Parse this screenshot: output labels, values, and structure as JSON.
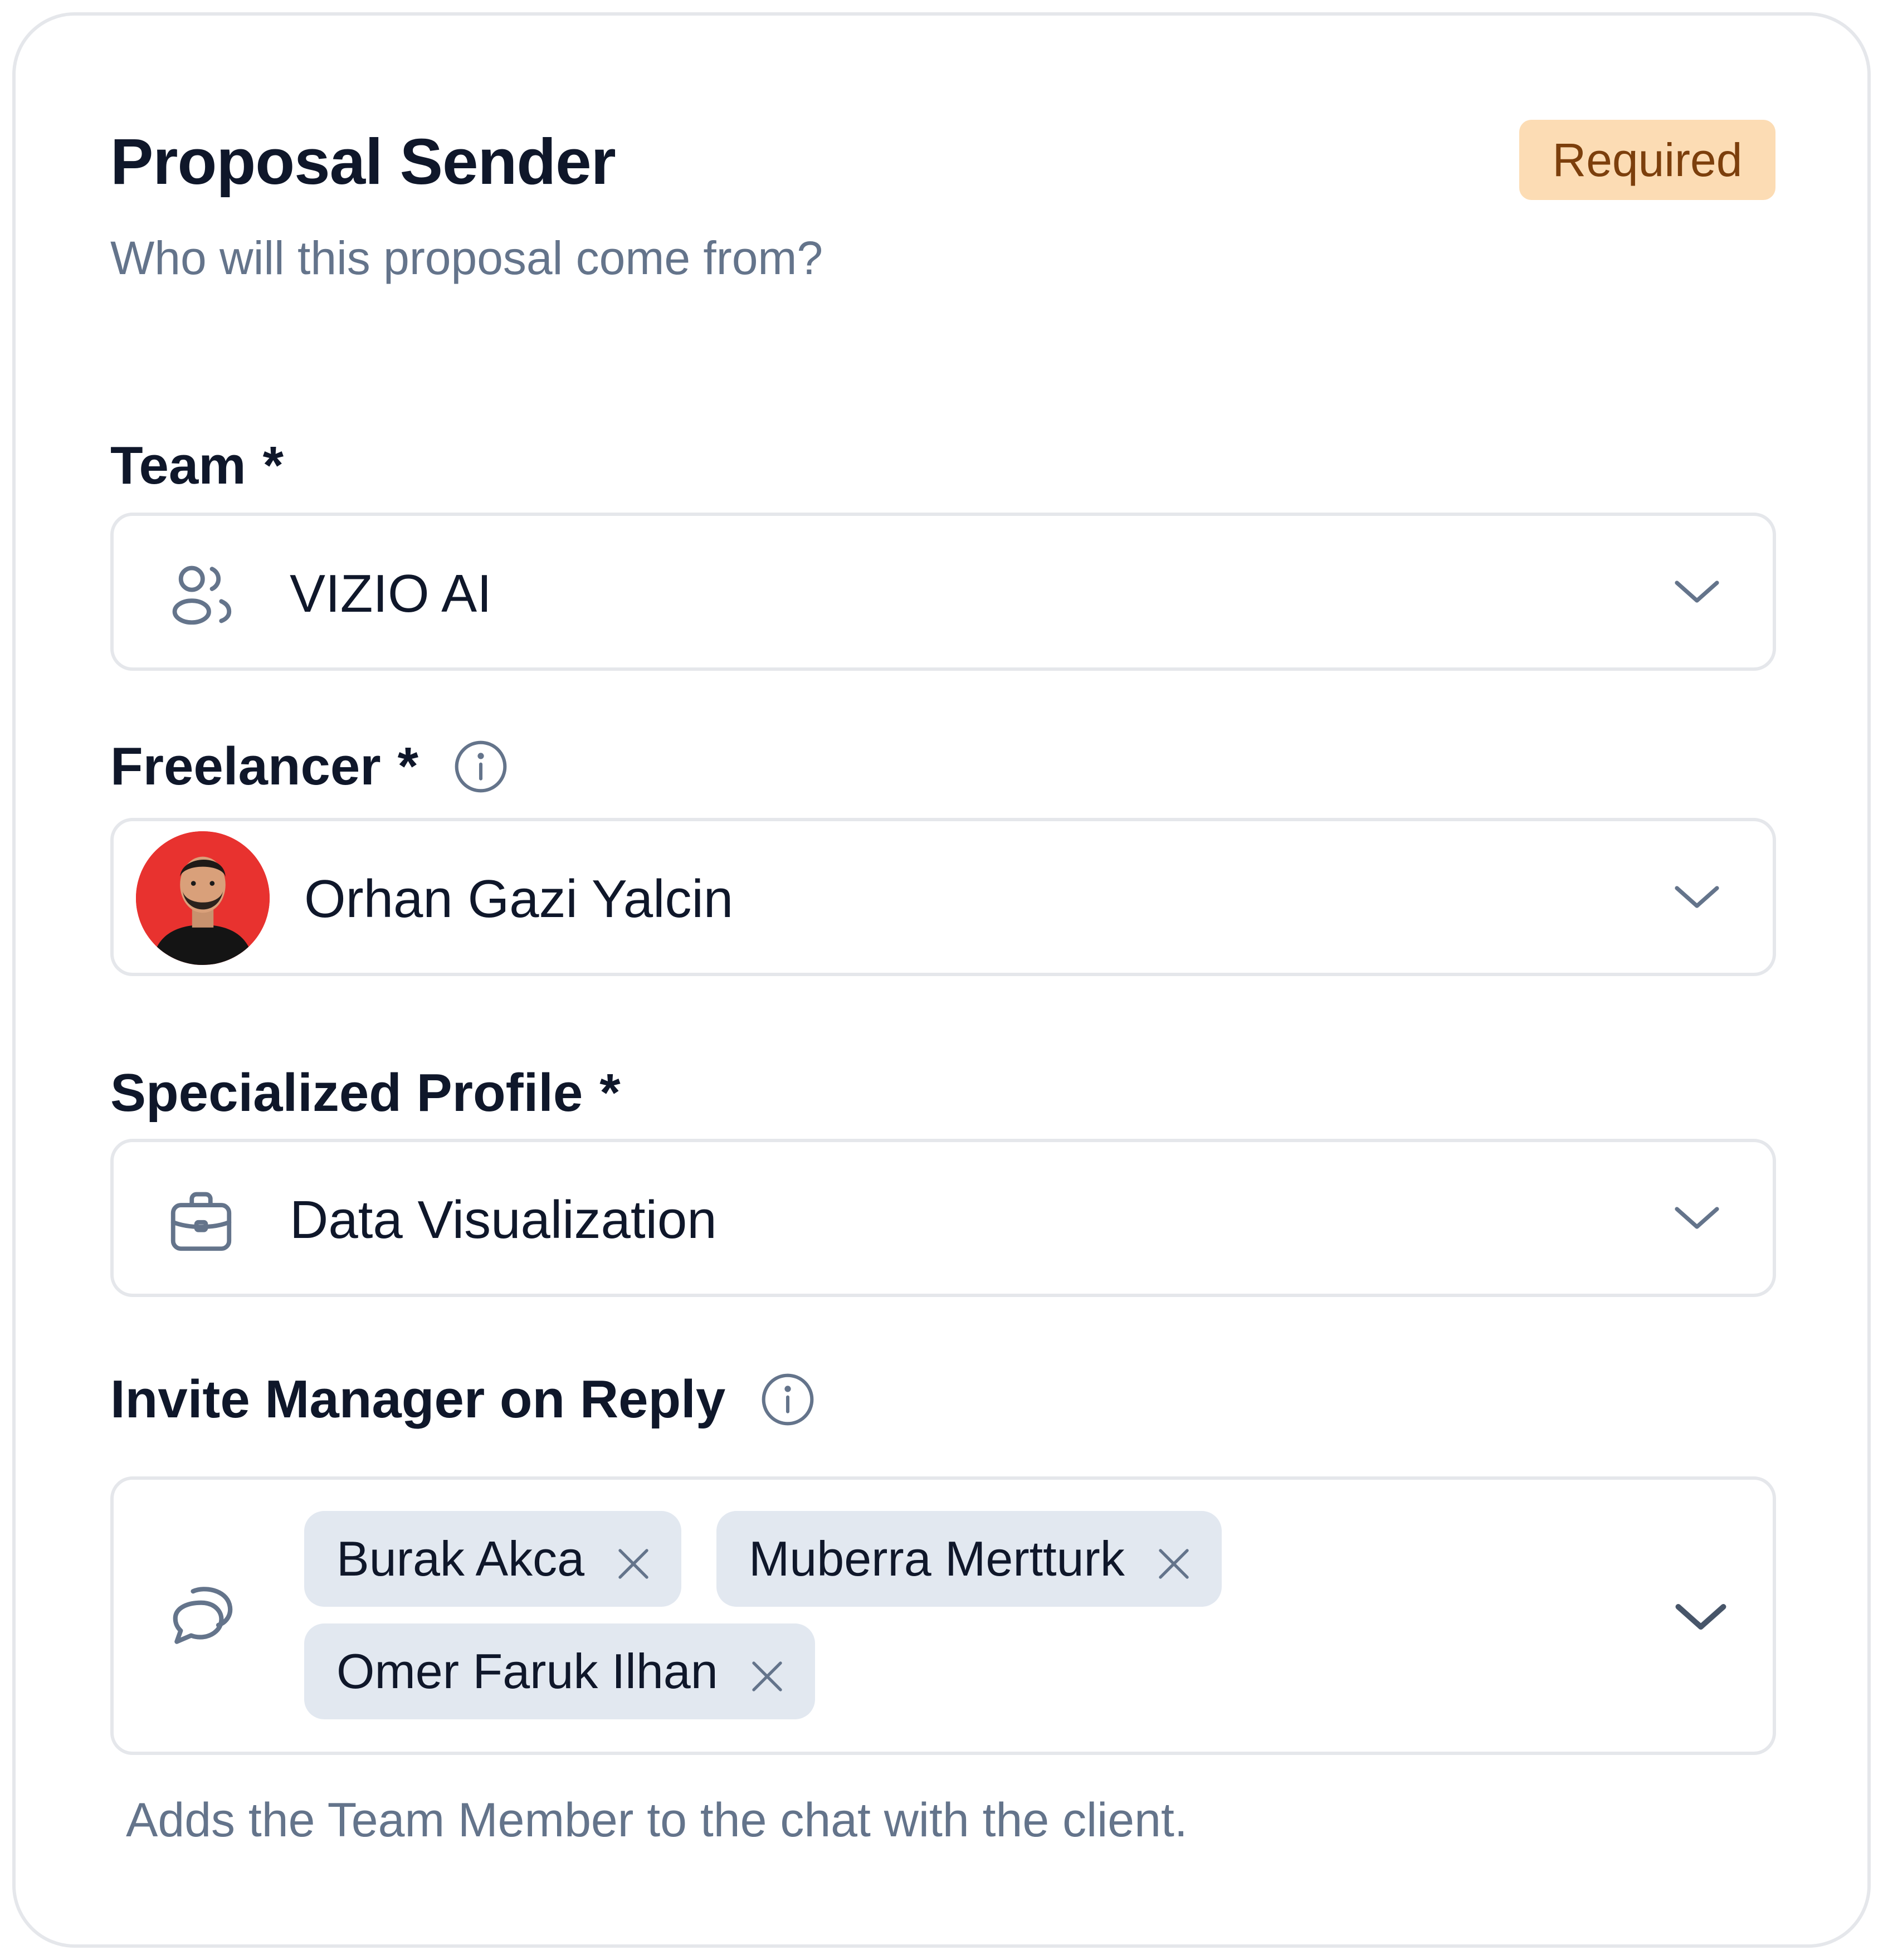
{
  "header": {
    "title": "Proposal Sender",
    "subtitle": "Who will this proposal come from?",
    "badge": "Required",
    "badge_color": "#fcdcb4"
  },
  "team": {
    "label": "Team",
    "required_mark": "*",
    "value": "VIZIO AI",
    "icon": "users-icon"
  },
  "freelancer": {
    "label": "Freelancer",
    "required_mark": "*",
    "value": "Orhan Gazi Yalcin",
    "info_icon": "info-icon"
  },
  "specialized_profile": {
    "label": "Specialized Profile",
    "required_mark": "*",
    "value": "Data Visualization",
    "icon": "briefcase-icon"
  },
  "invite_manager": {
    "label": "Invite Manager on Reply",
    "info_icon": "info-icon",
    "icon": "chat-bubbles-icon",
    "chips": [
      {
        "label": "Burak Akca"
      },
      {
        "label": "Muberra Mertturk"
      },
      {
        "label": "Omer Faruk Ilhan"
      }
    ],
    "helper": "Adds the Team Member to the chat with the client."
  }
}
